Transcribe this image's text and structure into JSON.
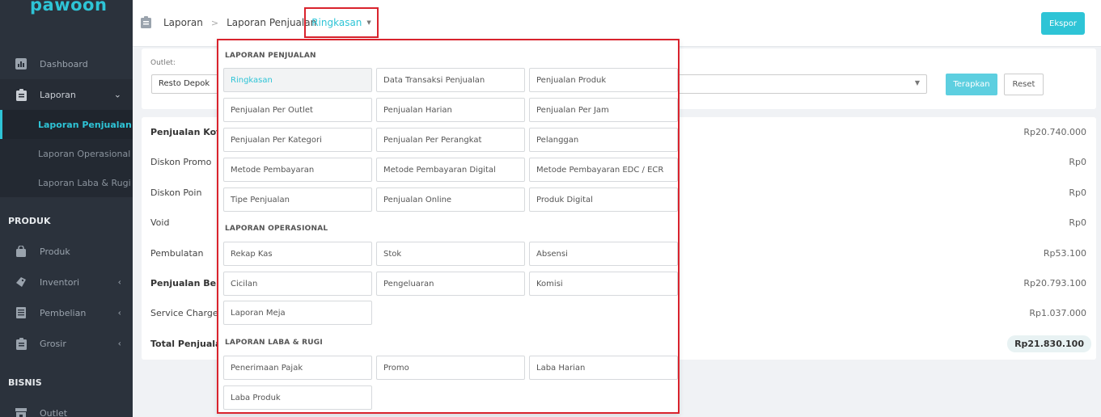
{
  "app": {
    "logo": "pawoon"
  },
  "sidebar": {
    "items": [
      {
        "label": "Dashboard"
      },
      {
        "label": "Laporan"
      }
    ],
    "laporan_sub": [
      {
        "label": "Laporan Penjualan"
      },
      {
        "label": "Laporan Operasional"
      },
      {
        "label": "Laporan Laba & Rugi"
      }
    ],
    "produk_title": "PRODUK",
    "produk_items": [
      {
        "label": "Produk"
      },
      {
        "label": "Inventori"
      },
      {
        "label": "Pembelian"
      },
      {
        "label": "Grosir"
      }
    ],
    "bisnis_title": "BISNIS",
    "bisnis_items": [
      {
        "label": "Outlet"
      }
    ]
  },
  "breadcrumb": {
    "items": [
      "Laporan",
      "Laporan Penjualan"
    ],
    "active": "Ringkasan"
  },
  "toolbar": {
    "export_label": "Ekspor"
  },
  "filter": {
    "outlet_label": "Outlet:",
    "outlet_value": "Resto Depok",
    "apply_label": "Terapkan",
    "reset_label": "Reset"
  },
  "summary": {
    "rows": [
      {
        "label": "Penjualan Kotor",
        "value": "Rp20.740.000"
      },
      {
        "label": "Diskon Promo",
        "value": "Rp0"
      },
      {
        "label": "Diskon Poin",
        "value": "Rp0"
      },
      {
        "label": "Void",
        "value": "Rp0"
      },
      {
        "label": "Pembulatan",
        "value": "Rp53.100"
      },
      {
        "label": "Penjualan Bersih",
        "value": "Rp20.793.100"
      },
      {
        "label": "Service Charge",
        "value": "Rp1.037.000"
      },
      {
        "label": "Total Penjualan",
        "value": "Rp21.830.100"
      }
    ]
  },
  "menu": {
    "penjualan_title": "LAPORAN PENJUALAN",
    "penjualan": [
      "Ringkasan",
      "Data Transaksi Penjualan",
      "Penjualan Produk",
      "Penjualan Per Outlet",
      "Penjualan Harian",
      "Penjualan Per Jam",
      "Penjualan Per Kategori",
      "Penjualan Per Perangkat",
      "Pelanggan",
      "Metode Pembayaran",
      "Metode Pembayaran Digital",
      "Metode Pembayaran EDC / ECR",
      "Tipe Penjualan",
      "Penjualan Online",
      "Produk Digital"
    ],
    "operasional_title": "LAPORAN OPERASIONAL",
    "operasional": [
      "Rekap Kas",
      "Stok",
      "Absensi",
      "Cicilan",
      "Pengeluaran",
      "Komisi",
      "Laporan Meja"
    ],
    "laba_title": "LAPORAN LABA & RUGI",
    "laba": [
      "Penerimaan Pajak",
      "Promo",
      "Laba Harian",
      "Laba Produk"
    ]
  }
}
